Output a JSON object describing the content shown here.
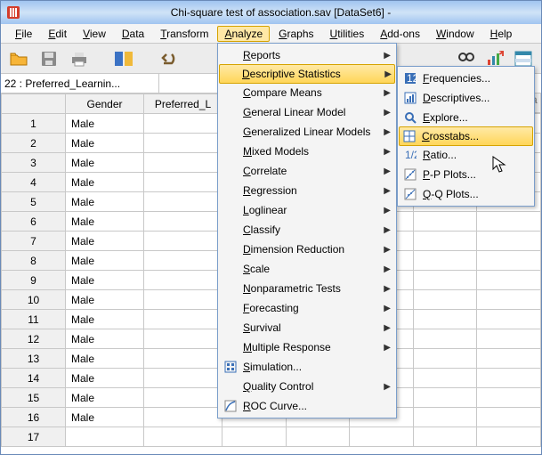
{
  "titlebar": {
    "title": "Chi-square test of association.sav [DataSet6]  -"
  },
  "menubar": [
    "File",
    "Edit",
    "View",
    "Data",
    "Transform",
    "Analyze",
    "Graphs",
    "Utilities",
    "Add-ons",
    "Window",
    "Help"
  ],
  "menubar_active_index": 5,
  "namebox": "22 : Preferred_Learnin...",
  "columns": [
    "Gender",
    "Preferred_L"
  ],
  "var_placeholder": "va",
  "rows": [
    {
      "n": 1,
      "gender": "Male"
    },
    {
      "n": 2,
      "gender": "Male"
    },
    {
      "n": 3,
      "gender": "Male"
    },
    {
      "n": 4,
      "gender": "Male"
    },
    {
      "n": 5,
      "gender": "Male"
    },
    {
      "n": 6,
      "gender": "Male"
    },
    {
      "n": 7,
      "gender": "Male"
    },
    {
      "n": 8,
      "gender": "Male"
    },
    {
      "n": 9,
      "gender": "Male"
    },
    {
      "n": 10,
      "gender": "Male"
    },
    {
      "n": 11,
      "gender": "Male"
    },
    {
      "n": 12,
      "gender": "Male"
    },
    {
      "n": 13,
      "gender": "Male"
    },
    {
      "n": 14,
      "gender": "Male"
    },
    {
      "n": 15,
      "gender": "Male"
    },
    {
      "n": 16,
      "gender": "Male"
    },
    {
      "n": 17,
      "gender": ""
    }
  ],
  "analyze_menu": [
    {
      "label": "Reports",
      "sub": true
    },
    {
      "label": "Descriptive Statistics",
      "sub": true,
      "highlight": true
    },
    {
      "label": "Compare Means",
      "sub": true
    },
    {
      "label": "General Linear Model",
      "sub": true
    },
    {
      "label": "Generalized Linear Models",
      "sub": true
    },
    {
      "label": "Mixed Models",
      "sub": true
    },
    {
      "label": "Correlate",
      "sub": true
    },
    {
      "label": "Regression",
      "sub": true
    },
    {
      "label": "Loglinear",
      "sub": true
    },
    {
      "label": "Classify",
      "sub": true
    },
    {
      "label": "Dimension Reduction",
      "sub": true
    },
    {
      "label": "Scale",
      "sub": true
    },
    {
      "label": "Nonparametric Tests",
      "sub": true
    },
    {
      "label": "Forecasting",
      "sub": true
    },
    {
      "label": "Survival",
      "sub": true
    },
    {
      "label": "Multiple Response",
      "sub": true
    },
    {
      "label": "Simulation...",
      "sub": false,
      "icon": "sim"
    },
    {
      "label": "Quality Control",
      "sub": true
    },
    {
      "label": "ROC Curve...",
      "sub": false,
      "icon": "roc"
    }
  ],
  "descriptive_menu": [
    {
      "label": "Frequencies...",
      "icon": "freq"
    },
    {
      "label": "Descriptives...",
      "icon": "desc"
    },
    {
      "label": "Explore...",
      "icon": "expl"
    },
    {
      "label": "Crosstabs...",
      "icon": "cross",
      "highlight": true
    },
    {
      "label": "Ratio...",
      "icon": "ratio"
    },
    {
      "label": "P-P Plots...",
      "icon": "pp"
    },
    {
      "label": "Q-Q Plots...",
      "icon": "qq"
    }
  ]
}
